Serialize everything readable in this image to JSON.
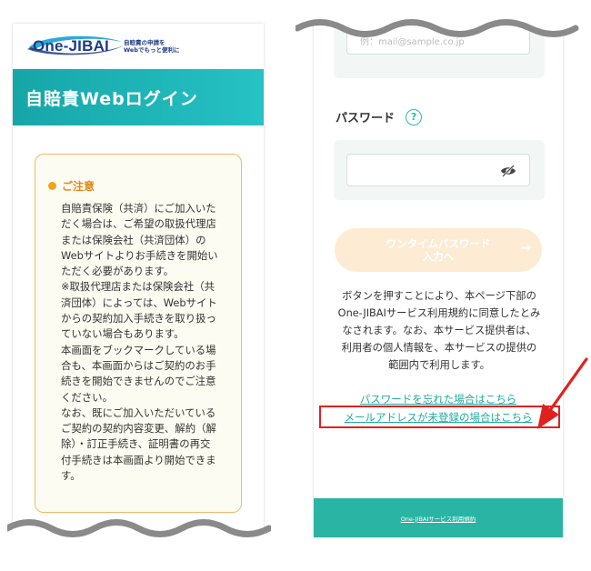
{
  "left": {
    "logo_text": "One-JIBAI",
    "logo_tagline_1": "自賠責の申請を",
    "logo_tagline_2": "Webでもっと便利に",
    "banner_title": "自賠責Webログイン",
    "notice_title": "ご注意",
    "notice_body": "自賠責保険（共済）にご加入いた\nだく場合は、ご希望の取扱代理店\nまたは保険会社（共済団体）の\nWebサイトよりお手続きを開始い\nただく必要があります。\n※取扱代理店または保険会社（共\n済団体）によっては、Webサイト\nからの契約加入手続きを取り扱っ\nていない場合もあります。\n本画面をブックマークしている場\n合も、本画面からはご契約のお手\n続きを開始できませんのでご注意\nください。\nなお、既にご加入いただいている\nご契約の契約内容変更、解約（解\n除）・訂正手続き、証明書の再交\n付手続きは本画面より開始できま\nす。"
  },
  "right": {
    "email_placeholder": "例：mail@sample.co.jp",
    "password_label": "パスワード",
    "help_icon_glyph": "?",
    "otp_button_label": "ワンタイムパスワード\n入力へ",
    "otp_arrow_glyph": "→",
    "consent_text": "ボタンを押すことにより、本ページ下部の\nOne-JIBAIサービス利用規約に同意したとみ\nなされます。なお、本サービス提供者は、\n利用者の個人情報を、本サービスの提供の\n範囲内で利用します。",
    "forgot_password_link": "パスワードを忘れた場合はこちら",
    "unregistered_email_link": "メールアドレスが未登録の場合はこちら",
    "footer_link": "One-JIBAIサービス利用規約"
  },
  "colors": {
    "brand_teal": "#1fb5b4",
    "notice_orange": "#e08a1e",
    "annotation_red": "#e0211f",
    "footer_green": "#2ab4a4"
  },
  "icons": [
    "logo-swoosh-icon",
    "notice-dot-icon",
    "help-icon",
    "eye-slash-icon",
    "arrow-right-icon",
    "red-pointer-arrow-icon"
  ]
}
